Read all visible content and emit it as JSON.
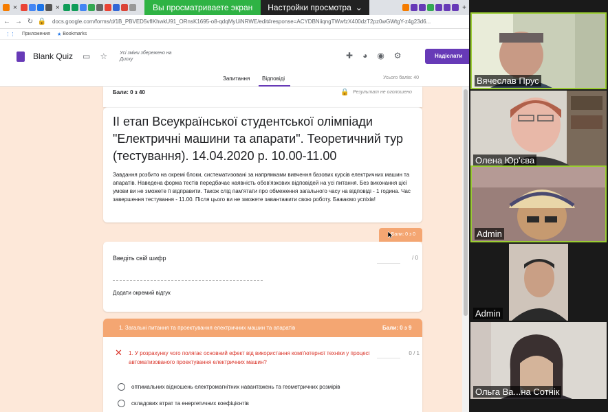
{
  "browser": {
    "share_banner": "Вы просматриваете экран",
    "view_settings": "Настройки просмотра",
    "url": "docs.google.com/forms/d/1B_PBVED5vfIKhwkU91_ORnsK1695-o8-qdqMyUiNRWE/edit#response=ACYDBNiiqngTWwfzX400dzT2pz0wGWtgY-z4g23d6...",
    "bookmarks": [
      {
        "label": "Приложения"
      },
      {
        "label": "Bookmarks"
      }
    ]
  },
  "form": {
    "app_title": "Blank Quiz",
    "saved_status": "Усі зміни збережено на Диску",
    "send_label": "Надіслати",
    "tabs": [
      {
        "label": "Запитання"
      },
      {
        "label": "Відповіді"
      }
    ],
    "total_points": "Усього балів: 40",
    "points_header": "Бали: 0 з 40",
    "results_note": "Результат не оголошено",
    "title": "ІІ етап Всеукраїнської студентської олімпіади \"Електричні машини та апарати\". Теоретичний тур (тестування). 14.04.2020 р. 10.00-11.00",
    "description": "Завдання розбито на окремі блоки, систематизовані за напрямками вивчення базових курсів електричних машин та апаратів. Наведена форма тестів передбачає наявність обов'язкових відповідей на усі питання. Без виконання цієї умови ви не зможете її відправити. Також слід пам'ятати про обмеження загального часу на відповіді - 1 година. Час завершення тестування - 11.00. Після цього ви не зможете завантажити свою роботу. Бажаємо успіхів!",
    "badge_points": "Бали: 0 з 0",
    "cipher": {
      "label": "Введіть свій шифр",
      "score": "/ 0",
      "feedback": "Додати окремий відгук"
    },
    "section": {
      "title": "1. Загальні питання та проектування електричних машин та апаратів",
      "points": "Бали: 0 з 9",
      "question": "1. У розрахунку чого полягає основний ефект від використання комп'ютерної техніки у процесі автоматизованого проектування електричних машин?",
      "qscore": "0 / 1",
      "options": [
        "оптимальних відношень електромагнітних навантажень та геометричних розмірів",
        "складових втрат та енергетичних коефіцієнтів"
      ]
    }
  },
  "participants": [
    {
      "name": "Вячеслав Прус",
      "active": true
    },
    {
      "name": "Олена Юр'єва",
      "active": false
    },
    {
      "name": "Admin",
      "active": true
    },
    {
      "name": "Admin",
      "active": false
    },
    {
      "name": "Ольга Ва...на Сотнік",
      "active": false
    }
  ],
  "colors": {
    "accent": "#673ab7",
    "section": "#f4a672",
    "page_bg": "#fde8d9",
    "error": "#d93025",
    "share_green": "#2fb344"
  }
}
